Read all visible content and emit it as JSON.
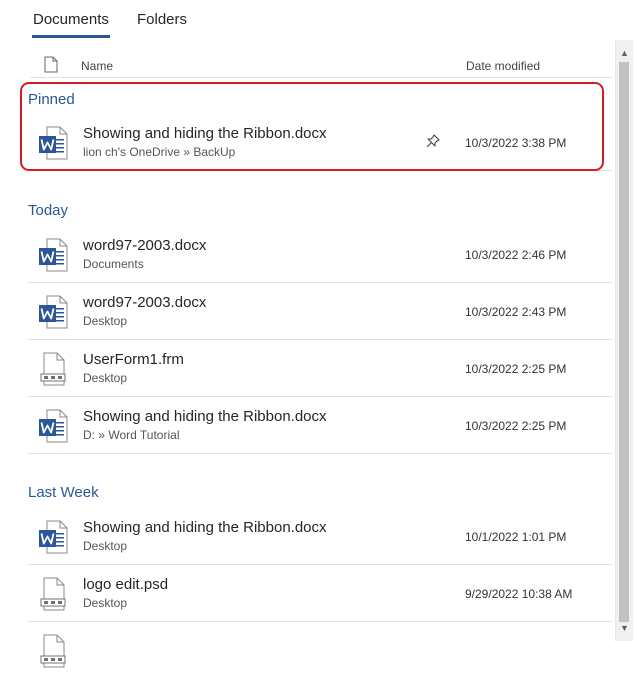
{
  "tabs": {
    "documents": "Documents",
    "folders": "Folders"
  },
  "columns": {
    "name": "Name",
    "date_modified": "Date modified"
  },
  "pinned": {
    "title": "Pinned",
    "items": [
      {
        "name": "Showing and hiding the Ribbon.docx",
        "location": "lion ch's OneDrive » BackUp",
        "date": "10/3/2022 3:38 PM",
        "icon": "word-doc-icon"
      }
    ]
  },
  "today": {
    "title": "Today",
    "items": [
      {
        "name": "word97-2003.docx",
        "location": "Documents",
        "date": "10/3/2022 2:46 PM",
        "icon": "word-doc-icon"
      },
      {
        "name": "word97-2003.docx",
        "location": "Desktop",
        "date": "10/3/2022 2:43 PM",
        "icon": "word-doc-icon"
      },
      {
        "name": "UserForm1.frm",
        "location": "Desktop",
        "date": "10/3/2022 2:25 PM",
        "icon": "generic-file-icon"
      },
      {
        "name": "Showing and hiding the Ribbon.docx",
        "location": "D: » Word Tutorial",
        "date": "10/3/2022 2:25 PM",
        "icon": "word-doc-icon"
      }
    ]
  },
  "last_week": {
    "title": "Last Week",
    "items": [
      {
        "name": "Showing and hiding the Ribbon.docx",
        "location": "Desktop",
        "date": "10/1/2022 1:01 PM",
        "icon": "word-doc-icon"
      },
      {
        "name": "logo edit.psd",
        "location": "Desktop",
        "date": "9/29/2022 10:38 AM",
        "icon": "generic-file-icon"
      }
    ]
  },
  "colors": {
    "accent": "#2b579a",
    "highlight": "#d61a2a"
  }
}
